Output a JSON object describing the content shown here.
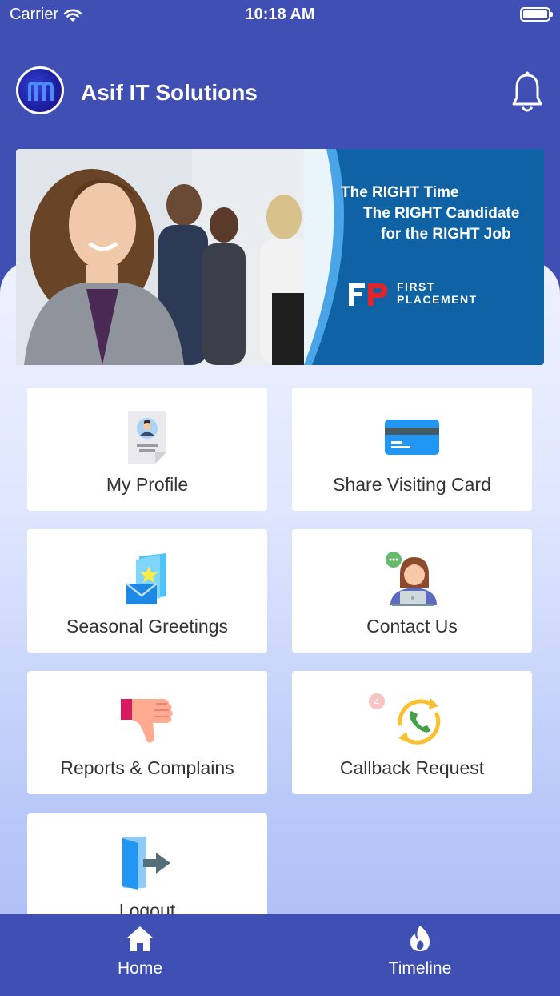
{
  "status_bar": {
    "carrier": "Carrier",
    "time": "10:18 AM"
  },
  "header": {
    "title": "Asif IT Solutions"
  },
  "banner": {
    "line1": "The RIGHT Time",
    "line2": "The RIGHT Candidate",
    "line3": "for the RIGHT Job",
    "brand_line1": "FIRST",
    "brand_line2": "PLACEMENT"
  },
  "menu": {
    "items": [
      {
        "label": "My Profile",
        "icon": "profile-document-icon"
      },
      {
        "label": "Share Visiting Card",
        "icon": "card-icon"
      },
      {
        "label": "Seasonal Greetings",
        "icon": "greeting-card-icon"
      },
      {
        "label": "Contact Us",
        "icon": "support-agent-icon"
      },
      {
        "label": "Reports & Complains",
        "icon": "thumbs-down-icon"
      },
      {
        "label": "Callback Request",
        "icon": "phone-callback-icon"
      },
      {
        "label": "Logout",
        "icon": "logout-icon"
      }
    ],
    "callback_badge": "4"
  },
  "tab_bar": {
    "home": "Home",
    "timeline": "Timeline"
  },
  "colors": {
    "primary": "#3f4fb4",
    "banner_blue": "#0f62a3",
    "accent_red": "#e0242a"
  }
}
